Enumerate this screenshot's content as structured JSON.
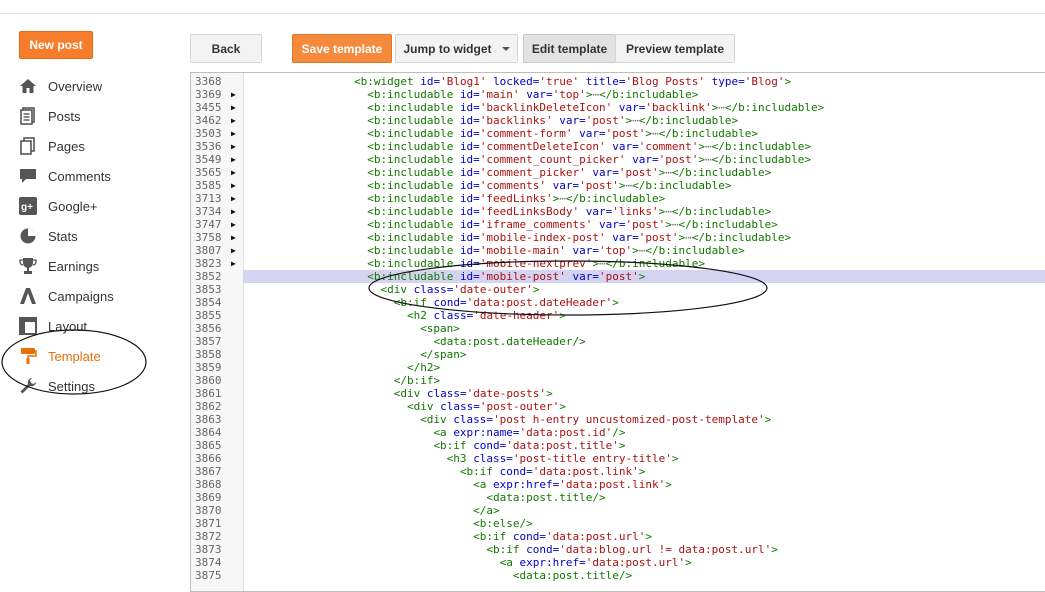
{
  "sidebar": {
    "new_post": "New post",
    "items": [
      {
        "label": "Overview",
        "icon": "home-icon"
      },
      {
        "label": "Posts",
        "icon": "posts-icon"
      },
      {
        "label": "Pages",
        "icon": "pages-icon"
      },
      {
        "label": "Comments",
        "icon": "comments-icon"
      },
      {
        "label": "Google+",
        "icon": "google-plus-icon"
      },
      {
        "label": "Stats",
        "icon": "stats-icon"
      },
      {
        "label": "Earnings",
        "icon": "earnings-icon"
      },
      {
        "label": "Campaigns",
        "icon": "campaigns-icon"
      },
      {
        "label": "Layout",
        "icon": "layout-icon"
      },
      {
        "label": "Template",
        "icon": "template-icon",
        "active": true
      },
      {
        "label": "Settings",
        "icon": "settings-icon"
      }
    ]
  },
  "toolbar": {
    "back": "Back",
    "save_template": "Save template",
    "jump_to_widget": "Jump to widget",
    "edit_template": "Edit template",
    "preview_template": "Preview template"
  },
  "colors": {
    "accent_orange": "#f57d2b",
    "active_nav": "#e8710a",
    "highlight_line": "#d5d3f2",
    "tag_green": "#117700",
    "attr_blue": "#0000cc",
    "value_red": "#aa1111"
  },
  "editor": {
    "lines": [
      {
        "n": "3368",
        "fold": false,
        "indent": 16,
        "tokens": [
          [
            "t",
            "<b:widget "
          ],
          [
            "a",
            "id="
          ],
          [
            "v",
            "'Blog1'"
          ],
          [
            "p",
            " "
          ],
          [
            "a",
            "locked="
          ],
          [
            "v",
            "'true'"
          ],
          [
            "p",
            " "
          ],
          [
            "a",
            "title="
          ],
          [
            "v",
            "'Blog Posts'"
          ],
          [
            "p",
            " "
          ],
          [
            "a",
            "type="
          ],
          [
            "v",
            "'Blog'"
          ],
          [
            "t",
            ">"
          ]
        ]
      },
      {
        "n": "3369",
        "fold": true,
        "indent": 18,
        "tokens": [
          [
            "t",
            "<b:includable "
          ],
          [
            "a",
            "id="
          ],
          [
            "v",
            "'main'"
          ],
          [
            "p",
            " "
          ],
          [
            "a",
            "var="
          ],
          [
            "v",
            "'top'"
          ],
          [
            "t",
            ">"
          ],
          [
            "e",
            "⋯"
          ],
          [
            "t",
            "</b:includable>"
          ]
        ]
      },
      {
        "n": "3455",
        "fold": true,
        "indent": 18,
        "tokens": [
          [
            "t",
            "<b:includable "
          ],
          [
            "a",
            "id="
          ],
          [
            "v",
            "'backlinkDeleteIcon'"
          ],
          [
            "p",
            " "
          ],
          [
            "a",
            "var="
          ],
          [
            "v",
            "'backlink'"
          ],
          [
            "t",
            ">"
          ],
          [
            "e",
            "⋯"
          ],
          [
            "t",
            "</b:includable>"
          ]
        ]
      },
      {
        "n": "3462",
        "fold": true,
        "indent": 18,
        "tokens": [
          [
            "t",
            "<b:includable "
          ],
          [
            "a",
            "id="
          ],
          [
            "v",
            "'backlinks'"
          ],
          [
            "p",
            " "
          ],
          [
            "a",
            "var="
          ],
          [
            "v",
            "'post'"
          ],
          [
            "t",
            ">"
          ],
          [
            "e",
            "⋯"
          ],
          [
            "t",
            "</b:includable>"
          ]
        ]
      },
      {
        "n": "3503",
        "fold": true,
        "indent": 18,
        "tokens": [
          [
            "t",
            "<b:includable "
          ],
          [
            "a",
            "id="
          ],
          [
            "v",
            "'comment-form'"
          ],
          [
            "p",
            " "
          ],
          [
            "a",
            "var="
          ],
          [
            "v",
            "'post'"
          ],
          [
            "t",
            ">"
          ],
          [
            "e",
            "⋯"
          ],
          [
            "t",
            "</b:includable>"
          ]
        ]
      },
      {
        "n": "3536",
        "fold": true,
        "indent": 18,
        "tokens": [
          [
            "t",
            "<b:includable "
          ],
          [
            "a",
            "id="
          ],
          [
            "v",
            "'commentDeleteIcon'"
          ],
          [
            "p",
            " "
          ],
          [
            "a",
            "var="
          ],
          [
            "v",
            "'comment'"
          ],
          [
            "t",
            ">"
          ],
          [
            "e",
            "⋯"
          ],
          [
            "t",
            "</b:includable>"
          ]
        ]
      },
      {
        "n": "3549",
        "fold": true,
        "indent": 18,
        "tokens": [
          [
            "t",
            "<b:includable "
          ],
          [
            "a",
            "id="
          ],
          [
            "v",
            "'comment_count_picker'"
          ],
          [
            "p",
            " "
          ],
          [
            "a",
            "var="
          ],
          [
            "v",
            "'post'"
          ],
          [
            "t",
            ">"
          ],
          [
            "e",
            "⋯"
          ],
          [
            "t",
            "</b:includable>"
          ]
        ]
      },
      {
        "n": "3565",
        "fold": true,
        "indent": 18,
        "tokens": [
          [
            "t",
            "<b:includable "
          ],
          [
            "a",
            "id="
          ],
          [
            "v",
            "'comment_picker'"
          ],
          [
            "p",
            " "
          ],
          [
            "a",
            "var="
          ],
          [
            "v",
            "'post'"
          ],
          [
            "t",
            ">"
          ],
          [
            "e",
            "⋯"
          ],
          [
            "t",
            "</b:includable>"
          ]
        ]
      },
      {
        "n": "3585",
        "fold": true,
        "indent": 18,
        "tokens": [
          [
            "t",
            "<b:includable "
          ],
          [
            "a",
            "id="
          ],
          [
            "v",
            "'comments'"
          ],
          [
            "p",
            " "
          ],
          [
            "a",
            "var="
          ],
          [
            "v",
            "'post'"
          ],
          [
            "t",
            ">"
          ],
          [
            "e",
            "⋯"
          ],
          [
            "t",
            "</b:includable>"
          ]
        ]
      },
      {
        "n": "3713",
        "fold": true,
        "indent": 18,
        "tokens": [
          [
            "t",
            "<b:includable "
          ],
          [
            "a",
            "id="
          ],
          [
            "v",
            "'feedLinks'"
          ],
          [
            "t",
            ">"
          ],
          [
            "e",
            "⋯"
          ],
          [
            "t",
            "</b:includable>"
          ]
        ]
      },
      {
        "n": "3734",
        "fold": true,
        "indent": 18,
        "tokens": [
          [
            "t",
            "<b:includable "
          ],
          [
            "a",
            "id="
          ],
          [
            "v",
            "'feedLinksBody'"
          ],
          [
            "p",
            " "
          ],
          [
            "a",
            "var="
          ],
          [
            "v",
            "'links'"
          ],
          [
            "t",
            ">"
          ],
          [
            "e",
            "⋯"
          ],
          [
            "t",
            "</b:includable>"
          ]
        ]
      },
      {
        "n": "3747",
        "fold": true,
        "indent": 18,
        "tokens": [
          [
            "t",
            "<b:includable "
          ],
          [
            "a",
            "id="
          ],
          [
            "v",
            "'iframe_comments'"
          ],
          [
            "p",
            " "
          ],
          [
            "a",
            "var="
          ],
          [
            "v",
            "'post'"
          ],
          [
            "t",
            ">"
          ],
          [
            "e",
            "⋯"
          ],
          [
            "t",
            "</b:includable>"
          ]
        ]
      },
      {
        "n": "3758",
        "fold": true,
        "indent": 18,
        "tokens": [
          [
            "t",
            "<b:includable "
          ],
          [
            "a",
            "id="
          ],
          [
            "v",
            "'mobile-index-post'"
          ],
          [
            "p",
            " "
          ],
          [
            "a",
            "var="
          ],
          [
            "v",
            "'post'"
          ],
          [
            "t",
            ">"
          ],
          [
            "e",
            "⋯"
          ],
          [
            "t",
            "</b:includable>"
          ]
        ]
      },
      {
        "n": "3807",
        "fold": true,
        "indent": 18,
        "tokens": [
          [
            "t",
            "<b:includable "
          ],
          [
            "a",
            "id="
          ],
          [
            "v",
            "'mobile-main'"
          ],
          [
            "p",
            " "
          ],
          [
            "a",
            "var="
          ],
          [
            "v",
            "'top'"
          ],
          [
            "t",
            ">"
          ],
          [
            "e",
            "⋯"
          ],
          [
            "t",
            "</b:includable>"
          ]
        ]
      },
      {
        "n": "3823",
        "fold": true,
        "indent": 18,
        "tokens": [
          [
            "t",
            "<b:includable "
          ],
          [
            "a",
            "id="
          ],
          [
            "v",
            "'mobile-nextprev'"
          ],
          [
            "t",
            ">"
          ],
          [
            "e",
            "⋯"
          ],
          [
            "t",
            "</b:includable>"
          ]
        ]
      },
      {
        "n": "3852",
        "fold": false,
        "hl": true,
        "indent": 18,
        "tokens": [
          [
            "t",
            "<b:includable "
          ],
          [
            "a",
            "id="
          ],
          [
            "v",
            "'mobile-post'"
          ],
          [
            "p",
            " "
          ],
          [
            "a",
            "var="
          ],
          [
            "v",
            "'post'"
          ],
          [
            "t",
            ">"
          ]
        ]
      },
      {
        "n": "3853",
        "fold": false,
        "indent": 20,
        "tokens": [
          [
            "t",
            "<div "
          ],
          [
            "a",
            "class="
          ],
          [
            "v",
            "'date-outer'"
          ],
          [
            "t",
            ">"
          ]
        ]
      },
      {
        "n": "3854",
        "fold": false,
        "indent": 22,
        "tokens": [
          [
            "t",
            "<b:if "
          ],
          [
            "a",
            "cond="
          ],
          [
            "v",
            "'data:post.dateHeader'"
          ],
          [
            "t",
            ">"
          ]
        ]
      },
      {
        "n": "3855",
        "fold": false,
        "indent": 24,
        "tokens": [
          [
            "t",
            "<h2 "
          ],
          [
            "a",
            "class="
          ],
          [
            "v",
            "'date-header'"
          ],
          [
            "t",
            ">"
          ]
        ]
      },
      {
        "n": "3856",
        "fold": false,
        "indent": 26,
        "tokens": [
          [
            "t",
            "<span>"
          ]
        ]
      },
      {
        "n": "3857",
        "fold": false,
        "indent": 28,
        "tokens": [
          [
            "t",
            "<data:post.dateHeader/>"
          ]
        ]
      },
      {
        "n": "3858",
        "fold": false,
        "indent": 26,
        "tokens": [
          [
            "t",
            "</span>"
          ]
        ]
      },
      {
        "n": "3859",
        "fold": false,
        "indent": 24,
        "tokens": [
          [
            "t",
            "</h2>"
          ]
        ]
      },
      {
        "n": "3860",
        "fold": false,
        "indent": 22,
        "tokens": [
          [
            "t",
            "</b:if>"
          ]
        ]
      },
      {
        "n": "3861",
        "fold": false,
        "indent": 22,
        "tokens": [
          [
            "t",
            "<div "
          ],
          [
            "a",
            "class="
          ],
          [
            "v",
            "'date-posts'"
          ],
          [
            "t",
            ">"
          ]
        ]
      },
      {
        "n": "3862",
        "fold": false,
        "indent": 24,
        "tokens": [
          [
            "t",
            "<div "
          ],
          [
            "a",
            "class="
          ],
          [
            "v",
            "'post-outer'"
          ],
          [
            "t",
            ">"
          ]
        ]
      },
      {
        "n": "3863",
        "fold": false,
        "indent": 26,
        "tokens": [
          [
            "t",
            "<div "
          ],
          [
            "a",
            "class="
          ],
          [
            "v",
            "'post h-entry uncustomized-post-template'"
          ],
          [
            "t",
            ">"
          ]
        ]
      },
      {
        "n": "3864",
        "fold": false,
        "indent": 28,
        "tokens": [
          [
            "t",
            "<a "
          ],
          [
            "a",
            "expr:name="
          ],
          [
            "v",
            "'data:post.id'"
          ],
          [
            "t",
            "/>"
          ]
        ]
      },
      {
        "n": "3865",
        "fold": false,
        "indent": 28,
        "tokens": [
          [
            "t",
            "<b:if "
          ],
          [
            "a",
            "cond="
          ],
          [
            "v",
            "'data:post.title'"
          ],
          [
            "t",
            ">"
          ]
        ]
      },
      {
        "n": "3866",
        "fold": false,
        "indent": 30,
        "tokens": [
          [
            "t",
            "<h3 "
          ],
          [
            "a",
            "class="
          ],
          [
            "v",
            "'post-title entry-title'"
          ],
          [
            "t",
            ">"
          ]
        ]
      },
      {
        "n": "3867",
        "fold": false,
        "indent": 32,
        "tokens": [
          [
            "t",
            "<b:if "
          ],
          [
            "a",
            "cond="
          ],
          [
            "v",
            "'data:post.link'"
          ],
          [
            "t",
            ">"
          ]
        ]
      },
      {
        "n": "3868",
        "fold": false,
        "indent": 34,
        "tokens": [
          [
            "t",
            "<a "
          ],
          [
            "a",
            "expr:href="
          ],
          [
            "v",
            "'data:post.link'"
          ],
          [
            "t",
            ">"
          ]
        ]
      },
      {
        "n": "3869",
        "fold": false,
        "indent": 36,
        "tokens": [
          [
            "t",
            "<data:post.title/>"
          ]
        ]
      },
      {
        "n": "3870",
        "fold": false,
        "indent": 34,
        "tokens": [
          [
            "t",
            "</a>"
          ]
        ]
      },
      {
        "n": "3871",
        "fold": false,
        "indent": 34,
        "tokens": [
          [
            "t",
            "<b:else/>"
          ]
        ]
      },
      {
        "n": "3872",
        "fold": false,
        "indent": 34,
        "tokens": [
          [
            "t",
            "<b:if "
          ],
          [
            "a",
            "cond="
          ],
          [
            "v",
            "'data:post.url'"
          ],
          [
            "t",
            ">"
          ]
        ]
      },
      {
        "n": "3873",
        "fold": false,
        "indent": 36,
        "tokens": [
          [
            "t",
            "<b:if "
          ],
          [
            "a",
            "cond="
          ],
          [
            "v",
            "'data:blog.url != data:post.url'"
          ],
          [
            "t",
            ">"
          ]
        ]
      },
      {
        "n": "3874",
        "fold": false,
        "indent": 38,
        "tokens": [
          [
            "t",
            "<a "
          ],
          [
            "a",
            "expr:href="
          ],
          [
            "v",
            "'data:post.url'"
          ],
          [
            "t",
            ">"
          ]
        ]
      },
      {
        "n": "3875",
        "fold": false,
        "indent": 40,
        "tokens": [
          [
            "t",
            "<data:post.title/>"
          ]
        ]
      }
    ]
  }
}
